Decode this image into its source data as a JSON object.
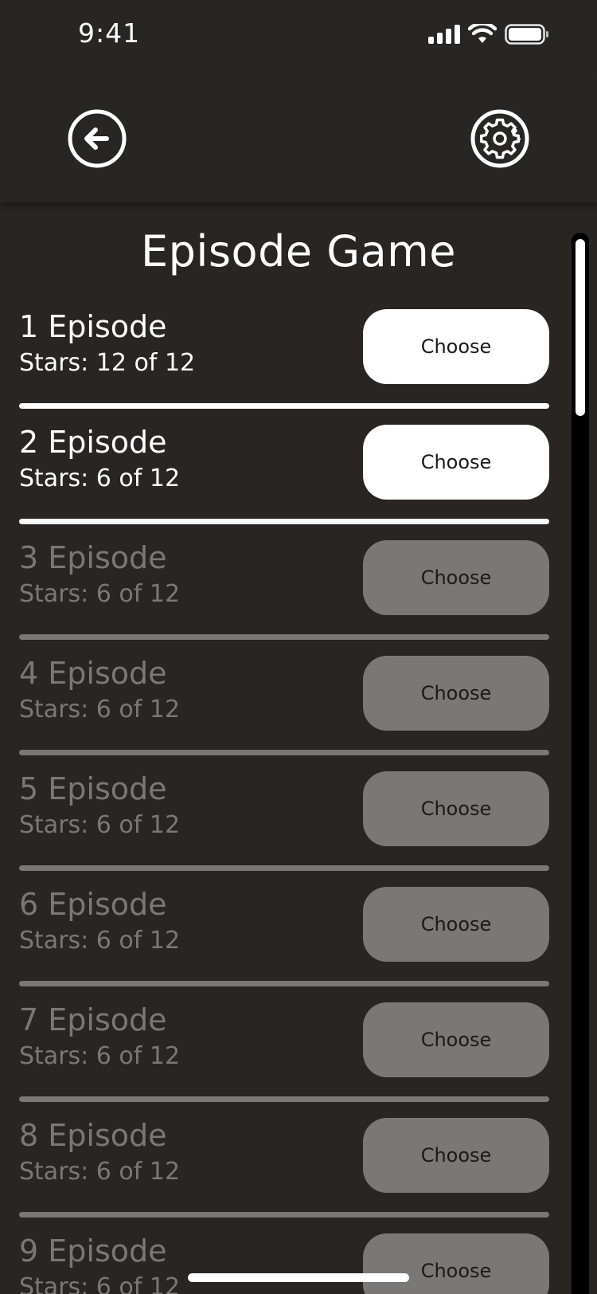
{
  "status_bar": {
    "time": "9:41",
    "icons": [
      "signal-icon",
      "wifi-icon",
      "battery-icon"
    ]
  },
  "header": {
    "back_icon": "back-arrow-icon",
    "settings_icon": "gear-icon"
  },
  "page": {
    "title": "Episode Game"
  },
  "episodes": [
    {
      "name": "1 Episode",
      "stars": "Stars: 12 of 12",
      "button": "Choose",
      "state": "unlocked"
    },
    {
      "name": "2 Episode",
      "stars": "Stars: 6 of 12",
      "button": "Choose",
      "state": "unlocked"
    },
    {
      "name": "3 Episode",
      "stars": "Stars: 6 of 12",
      "button": "Choose",
      "state": "locked"
    },
    {
      "name": "4 Episode",
      "stars": "Stars: 6 of 12",
      "button": "Choose",
      "state": "locked"
    },
    {
      "name": "5 Episode",
      "stars": "Stars: 6 of 12",
      "button": "Choose",
      "state": "locked"
    },
    {
      "name": "6 Episode",
      "stars": "Stars: 6 of 12",
      "button": "Choose",
      "state": "locked"
    },
    {
      "name": "7 Episode",
      "stars": "Stars: 6 of 12",
      "button": "Choose",
      "state": "locked"
    },
    {
      "name": "8 Episode",
      "stars": "Stars: 6 of 12",
      "button": "Choose",
      "state": "locked"
    },
    {
      "name": "9 Episode",
      "stars": "Stars: 6 of 12",
      "button": "Choose",
      "state": "locked"
    }
  ],
  "colors": {
    "background": "#282523",
    "header_background": "#272625",
    "active": "#ffffff",
    "inactive": "#7a7876"
  }
}
